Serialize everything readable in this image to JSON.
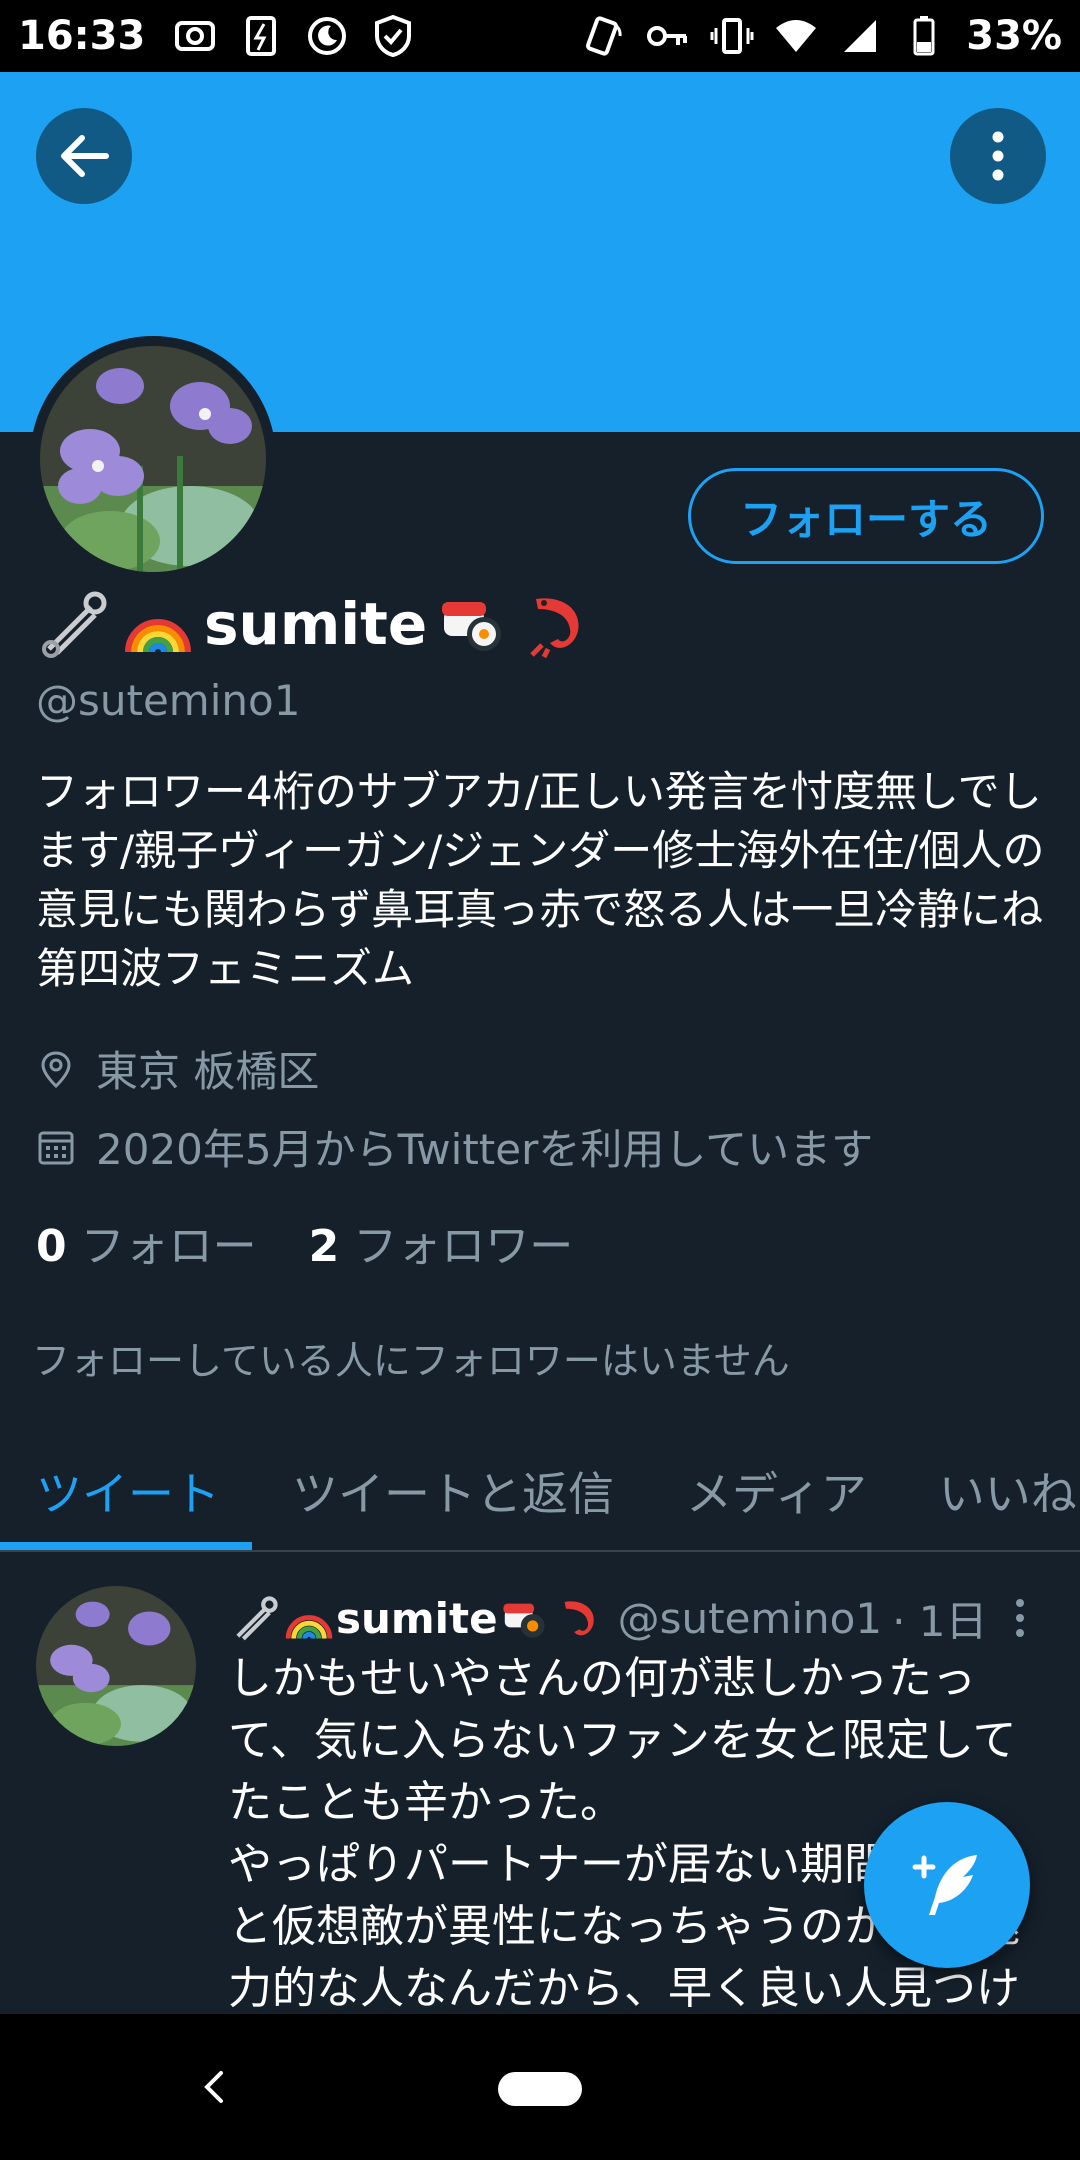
{
  "status_bar": {
    "time": "16:33",
    "battery": "33%",
    "left_icons": [
      "screenshot-icon",
      "data-saver-icon",
      "do-not-disturb-icon",
      "shield-icon"
    ],
    "right_icons": [
      "nfc-icon",
      "vpn-key-icon",
      "vibrate-icon",
      "wifi-icon",
      "cell-signal-icon",
      "battery-icon"
    ]
  },
  "header": {
    "banner_color": "#1da1f2",
    "back_icon": "arrow-left-icon",
    "more_icon": "more-vertical-icon"
  },
  "profile": {
    "display_name": "sumite",
    "name_emojis": [
      "safety-pin",
      "rainbow",
      "sushi",
      "shrimp"
    ],
    "handle": "@sutemino1",
    "follow_button": "フォローする",
    "bio": "フォロワー4桁のサブアカ/正しい発言を忖度無しでします/親子ヴィーガン/ジェンダー修士海外在住/個人の意見にも関わらず鼻耳真っ赤で怒る人は一旦冷静にね 第四波フェミニズム",
    "location": "東京 板橋区",
    "joined": "2020年5月からTwitterを利用しています",
    "following_count": "0",
    "following_label": "フォロー",
    "followers_count": "2",
    "followers_label": "フォロワー",
    "known_followers": "フォローしている人にフォロワーはいません"
  },
  "tabs": [
    {
      "label": "ツイート",
      "active": true
    },
    {
      "label": "ツイートと返信",
      "active": false
    },
    {
      "label": "メディア",
      "active": false
    },
    {
      "label": "いいね",
      "active": false
    }
  ],
  "tweet": {
    "name": "sumite",
    "handle": "@sutemino1",
    "time": "· 1日",
    "text": "しかもせいやさんの何が悲しかったって、気に入らないファンを女と限定してたことも辛かった。\nやっぱりパートナーが居ない期間が長いと仮想敵が異性になっちゃうのかな。魅力的な人なんだから、早く良い人見つけて欲しい。"
  },
  "colors": {
    "background": "#15202b",
    "accent": "#1da1f2",
    "secondary_text": "#8899a6",
    "divider": "#38444d"
  }
}
